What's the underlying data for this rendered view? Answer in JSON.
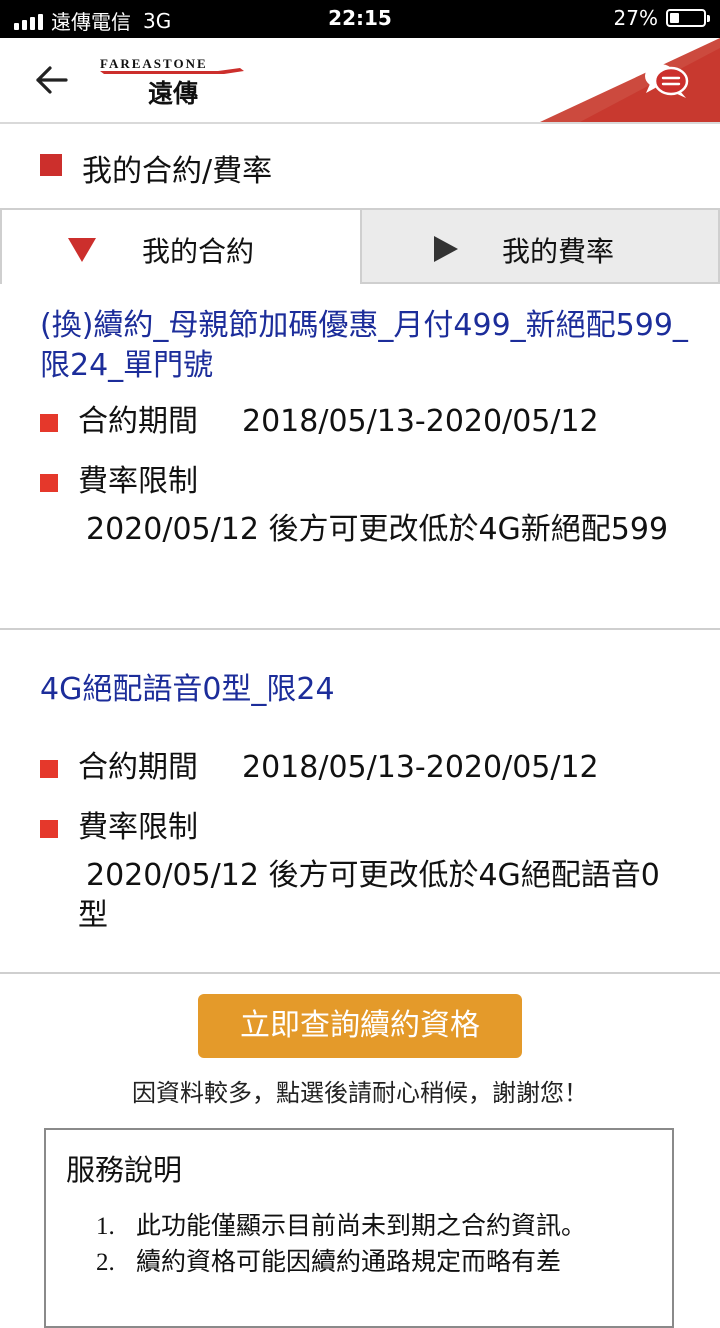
{
  "status_bar": {
    "carrier": "遠傳電信",
    "network": "3G",
    "time": "22:15",
    "battery_percent": "27%",
    "battery_level": 0.27
  },
  "header": {
    "logo_en": "FAREASTONE",
    "logo_zh": "遠傳",
    "brand_color": "#cc2f2c",
    "back_icon": "back-arrow-icon",
    "chat_icon": "chat-bubbles-icon"
  },
  "page": {
    "title": "我的合約/費率"
  },
  "tabs": [
    {
      "label": "我的合約",
      "selected": true
    },
    {
      "label": "我的費率",
      "selected": false
    }
  ],
  "contracts": [
    {
      "name": "(換)續約_母親節加碼優惠_月付499_新絕配599_限24_單門號",
      "period_label": "合約期間",
      "period_value": "2018/05/13-2020/05/12",
      "restriction_label": "費率限制",
      "restriction_text": "2020/05/12 後方可更改低於4G新絕配599"
    },
    {
      "name": "4G絕配語音0型_限24",
      "period_label": "合約期間",
      "period_value": "2018/05/13-2020/05/12",
      "restriction_label": "費率限制",
      "restriction_text": "2020/05/12 後方可更改低於4G絕配語音0型"
    }
  ],
  "actions": {
    "query_button": "立即查詢續約資格",
    "notice": "因資料較多，點選後請耐心稍候，謝謝您！"
  },
  "service": {
    "title": "服務說明",
    "items": [
      {
        "num": "1.",
        "text": "此功能僅顯示目前尚未到期之合約資訊。"
      },
      {
        "num": "2.",
        "text": "續約資格可能因續約通路規定而略有差"
      }
    ]
  },
  "colors": {
    "accent_red": "#cc2f2c",
    "bullet_red": "#e5382b",
    "contract_name_blue": "#1c2d9a",
    "button_orange": "#e49a2a",
    "inactive_tab_gray": "#ebebeb"
  }
}
